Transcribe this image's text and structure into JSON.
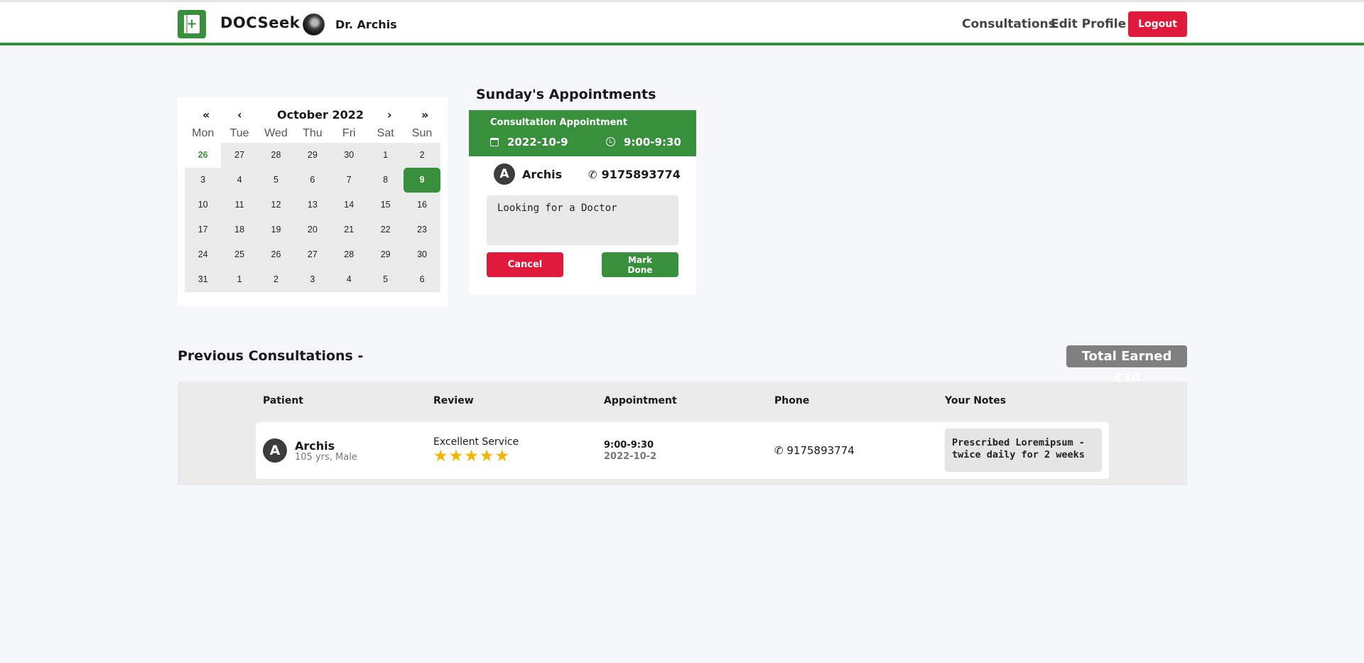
{
  "navbar": {
    "brand": "DOCSeek",
    "logo_glyph": "+",
    "doctor_name": "Dr. Archis",
    "links": [
      "Consultations",
      "Edit Profile"
    ],
    "logout_label": "Logout",
    "accent_color": "#38903c",
    "danger_color": "#e01a3c"
  },
  "calendar": {
    "prev_year": "«",
    "prev_month": "‹",
    "month_label": "October 2022",
    "next_month": "›",
    "next_year": "»",
    "weekdays": [
      "Mon",
      "Tue",
      "Wed",
      "Thu",
      "Fri",
      "Sat",
      "Sun"
    ],
    "days": [
      "26",
      "27",
      "28",
      "29",
      "30",
      "1",
      "2",
      "3",
      "4",
      "5",
      "6",
      "7",
      "8",
      "9",
      "10",
      "11",
      "12",
      "13",
      "14",
      "15",
      "16",
      "17",
      "18",
      "19",
      "20",
      "21",
      "22",
      "23",
      "24",
      "25",
      "26",
      "27",
      "28",
      "29",
      "30",
      "31",
      "1",
      "2",
      "3",
      "4",
      "5",
      "6"
    ],
    "today_index": 0,
    "selected_index": 13
  },
  "appointment": {
    "section_title": "Sunday's Appointments",
    "type": "Consultation Appointment",
    "date": "2022-10-9",
    "time": "9:00-9:30",
    "patient_initial": "A",
    "patient_name": "Archis",
    "phone": "9175893774",
    "note": "Looking for a Doctor",
    "cancel_label": "Cancel",
    "done_label": "Mark Done"
  },
  "previous": {
    "title": "Previous Consultations -",
    "total_earned": "Total Earned $30",
    "headers": [
      "Patient",
      "Review",
      "Appointment",
      "Phone",
      "Your Notes"
    ],
    "rows": [
      {
        "initial": "A",
        "name": "Archis",
        "details": "105 yrs, Male",
        "review": "Excellent Service",
        "stars": 5,
        "stars_text": "★★★★★",
        "time": "9:00-9:30",
        "date": "2022-10-2",
        "phone": "9175893774",
        "notes": "Prescribed Loremipsum - twice daily for 2 weeks"
      }
    ]
  }
}
